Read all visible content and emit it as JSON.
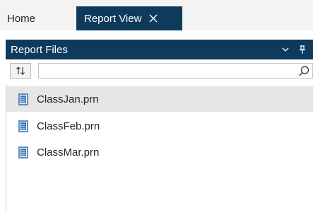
{
  "tabs": [
    {
      "label": "Home"
    },
    {
      "label": "Report View"
    }
  ],
  "panel": {
    "title": "Report Files"
  },
  "search": {
    "value": "",
    "placeholder": ""
  },
  "files": [
    {
      "name": "ClassJan.prn",
      "selected": true
    },
    {
      "name": "ClassFeb.prn",
      "selected": false
    },
    {
      "name": "ClassMar.prn",
      "selected": false
    }
  ],
  "colors": {
    "accent": "#0e3a5c",
    "selected_row": "#e6e6e6",
    "file_icon": "#2e6fb0"
  },
  "icons": {
    "tab_close": "close-icon",
    "dropdown": "chevron-down-icon",
    "pin": "pin-icon",
    "sort": "sort-icon",
    "search": "search-icon",
    "file": "document-icon"
  }
}
